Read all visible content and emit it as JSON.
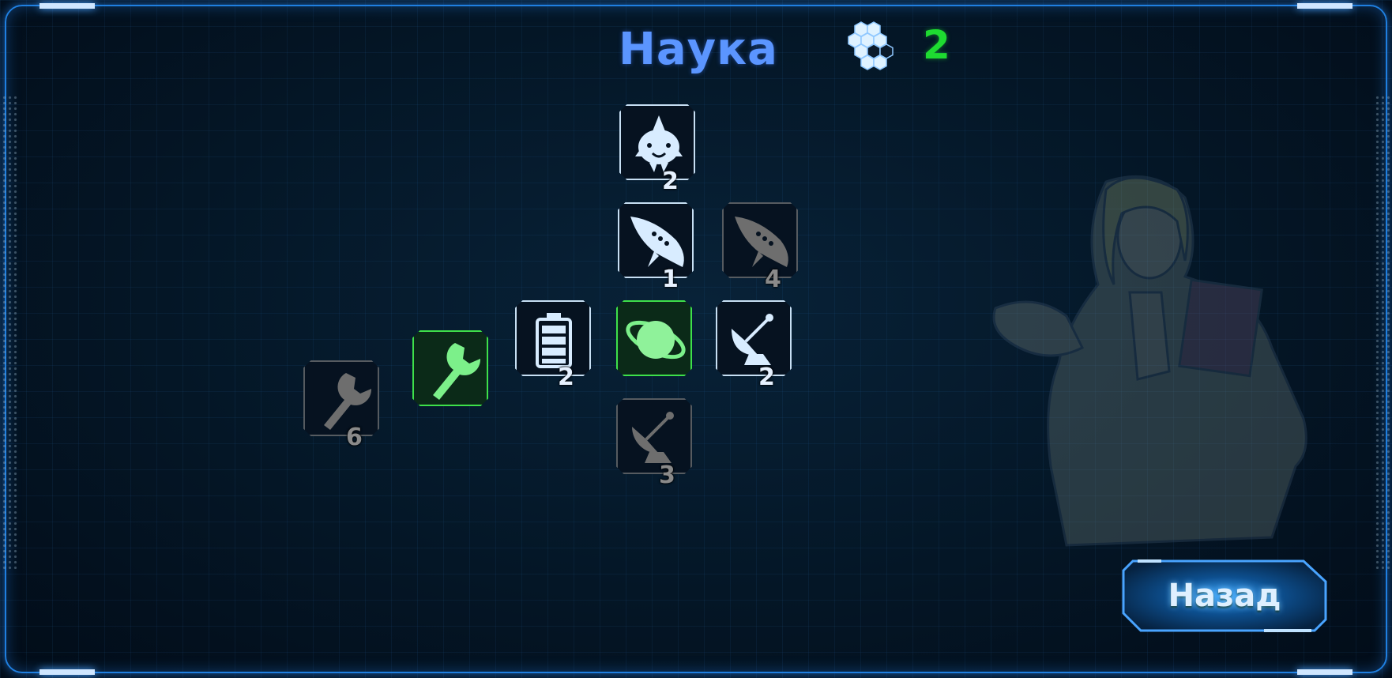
{
  "header": {
    "title": "Наука",
    "points": "2",
    "points_icon": "honeycomb-icon"
  },
  "tree": {
    "nodes": [
      {
        "id": "node-fish",
        "icon": "spiked-fish-icon",
        "state": "available",
        "number": "2"
      },
      {
        "id": "node-ship-white",
        "icon": "ufo-ship-icon",
        "state": "available",
        "number": "1"
      },
      {
        "id": "node-ship-gray",
        "icon": "ufo-ship-icon",
        "state": "locked",
        "number": "4"
      },
      {
        "id": "node-battery",
        "icon": "battery-icon",
        "state": "available",
        "number": "2"
      },
      {
        "id": "node-planet",
        "icon": "planet-icon",
        "state": "active",
        "number": ""
      },
      {
        "id": "node-dish-white",
        "icon": "satellite-dish-icon",
        "state": "available",
        "number": "2"
      },
      {
        "id": "node-wrench-green",
        "icon": "wrench-icon",
        "state": "active",
        "number": ""
      },
      {
        "id": "node-wrench-gray",
        "icon": "wrench-icon",
        "state": "locked",
        "number": "6"
      },
      {
        "id": "node-dish-gray",
        "icon": "satellite-dish-icon",
        "state": "locked",
        "number": "3"
      }
    ]
  },
  "colors": {
    "title": "#5b95ff",
    "points": "#1edb31",
    "active": "#3ee04a",
    "border": "#1f7fe0"
  },
  "footer": {
    "back_label": "Назад"
  }
}
